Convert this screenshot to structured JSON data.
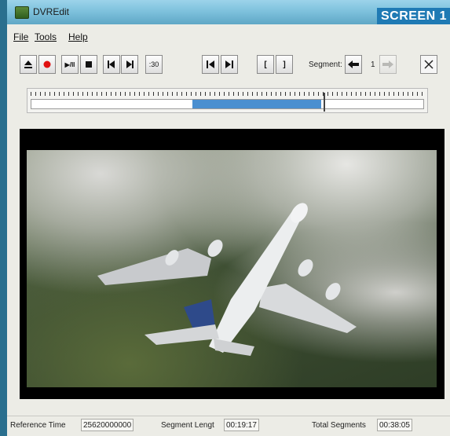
{
  "window": {
    "title": "DVREdit",
    "tag": "SCREEN 1"
  },
  "menu": {
    "file": "File",
    "tools": "Tools",
    "help": "Help"
  },
  "toolbar": {
    "eject_icon": "eject-icon",
    "record_icon": "record-icon",
    "play_pause_label": "▶/II",
    "stop_icon": "stop-icon",
    "prev_frame_icon": "step-back-icon",
    "next_frame_icon": "step-forward-icon",
    "skip30_label": ":30",
    "go_start_icon": "skip-to-start-icon",
    "go_end_icon": "skip-to-end-icon",
    "mark_in_label": "[",
    "mark_out_label": "]",
    "segment_label": "Segment:",
    "segment_value": "1"
  },
  "timeline": {
    "segment_start": 0.41,
    "segment_end": 0.74,
    "playhead": 0.745
  },
  "video": {
    "description_icon": "video-frame"
  },
  "status": {
    "ref_time_label": "Reference Time",
    "ref_time_value": "25620000000",
    "seg_len_label": "Segment Lengt",
    "seg_len_value": "00:19:17",
    "total_seg_label": "Total Segments",
    "total_seg_value": "00:38:05"
  },
  "colors": {
    "accent": "#1f7ab4",
    "segment": "#4a8fd0",
    "record": "#e01010"
  }
}
